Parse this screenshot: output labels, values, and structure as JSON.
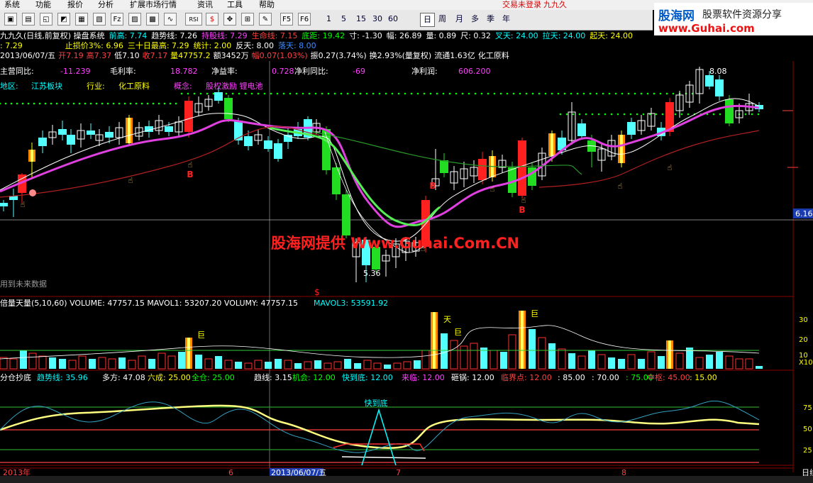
{
  "menu": [
    "系统",
    "功能",
    "报价",
    "分析",
    "扩展市场行情",
    "资讯",
    "工具",
    "帮助"
  ],
  "login_status": "交易未登录",
  "app_name": "九九久",
  "toolbar_periods": [
    "1",
    "5",
    "15",
    "30",
    "60",
    "日",
    "周",
    "月",
    "多",
    "季",
    "年"
  ],
  "toolbar_extra": [
    "RSI",
    "F5",
    "F6"
  ],
  "logo": {
    "brand": "股海网",
    "slogan": "股票软件资源分享",
    "url": "www.Guhai.com"
  },
  "title_bar": {
    "name": "九九久(日线,前复权) 操盘系统",
    "items": [
      {
        "label": "前高:",
        "value": "7.74",
        "color": "#00ffff"
      },
      {
        "label": "趋势线:",
        "value": "7.26",
        "color": "#ffffff"
      },
      {
        "label": "持股线:",
        "value": "7.29",
        "color": "#ff40ff"
      },
      {
        "label": "生命线:",
        "value": "7.15",
        "color": "#ff4040"
      },
      {
        "label": "底距:",
        "value": "19.42",
        "color": "#00ff00"
      },
      {
        "label": "寸:",
        "value": "-1.30",
        "color": "#ffffff"
      },
      {
        "label": "幅:",
        "value": "26.89",
        "color": "#ffffff"
      },
      {
        "label": "量:",
        "value": "0.89",
        "color": "#ffffff"
      },
      {
        "label": "尺:",
        "value": "0.32",
        "color": "#ffffff"
      },
      {
        "label": "叉天:",
        "value": "24.00",
        "color": "#00ffff"
      },
      {
        "label": "拉天:",
        "value": "24.00",
        "color": "#00ffff"
      },
      {
        "label": "起天:",
        "value": "24.00",
        "color": "#ffff00"
      }
    ]
  },
  "title_bar2": {
    "prefix": ": 7.29",
    "items": [
      {
        "label": "止损价3%:",
        "value": "6.96",
        "color": "#ffff00"
      },
      {
        "label": "三十日最高:",
        "value": "7.29",
        "color": "#ffff00"
      },
      {
        "label": "统计:",
        "value": "2.00",
        "color": "#ffff00"
      },
      {
        "label": "反天:",
        "value": "8.00",
        "color": "#ffffff"
      },
      {
        "label": "落天:",
        "value": "8.00",
        "color": "#3a8cff"
      }
    ]
  },
  "quote_line": {
    "date": "2013/06/07/五",
    "open": "开7.19",
    "high": "高7.37",
    "low": "低7.10",
    "close": "收7.17",
    "volume": "量47757.2",
    "amount": "额3452万",
    "change": "幅0.07(1.03%)",
    "amplitude": "振0.27(3.74%)",
    "turnover": "换2.93%(量复权)",
    "float": "流通1.63亿",
    "sector": "化工原料"
  },
  "fundamentals": [
    {
      "label": "主营同比:",
      "value": "-11.239"
    },
    {
      "label": "毛利率:",
      "value": "18.782"
    },
    {
      "label": "净益率:",
      "value": "0.728"
    },
    {
      "label": "净利同比:",
      "value": "-69"
    },
    {
      "label": "净利润:",
      "value": "606.200"
    }
  ],
  "region": {
    "region_label": "地区:",
    "region": "江苏板块",
    "industry_label": "行业:",
    "industry": "化工原料",
    "concept_label": "概念:",
    "concepts": "股权激励 锂电池"
  },
  "main_chart": {
    "price_marker": "6.16",
    "high_label": "8.08",
    "low_label": "5.36",
    "buy_signal": "B",
    "sell_signal": "$",
    "watermark": "股海网提供 Www.Guhai.Com.CN",
    "future_note": "用到未来数据"
  },
  "volume_panel": {
    "title": "倍量天量(5,10,60) VOLUME: 47757.15 MAVOL1: 53207.20 VOLUMY: 47757.15",
    "mavol3": "MAVOL3: 53591.92",
    "axis": [
      "30",
      "20",
      "10",
      "X10"
    ],
    "labels": [
      "巨",
      "天",
      "巨",
      "巨"
    ]
  },
  "osc_panel": {
    "items": [
      {
        "text": "分仓抄底",
        "color": "#ffffff"
      },
      {
        "text": "趋势线: 35.96",
        "color": "#00ffff"
      },
      {
        "text": "多方: 47.08",
        "color": "#ffffff"
      },
      {
        "text": "六成: 25.00",
        "color": "#ffff00"
      },
      {
        "text": "全仓: 25.00",
        "color": "#00ff00"
      },
      {
        "text": "趋线: 3.15",
        "color": "#ffffff"
      },
      {
        "text": "机会: 12.00",
        "color": "#00ff00"
      },
      {
        "text": "快到底: 12.00",
        "color": "#00ffff"
      },
      {
        "text": "来临: 12.00",
        "color": "#ff40ff"
      },
      {
        "text": "砸锅: 12.00",
        "color": "#ffffff"
      },
      {
        "text": "临界点: 12.00",
        "color": "#ff4040"
      },
      {
        "text": ": 85.00",
        "color": "#ffffff"
      },
      {
        "text": ": 70.00",
        "color": "#ffffff"
      },
      {
        "text": ": 75.00",
        "color": "#00ff00"
      },
      {
        "text": "中枢: 45.00",
        "color": "#ff4040"
      },
      {
        "text": ": 15.00",
        "color": "#ffff00"
      }
    ],
    "signal_label": "快到底",
    "axis": [
      "75",
      "50",
      "25"
    ]
  },
  "date_axis": {
    "year": "2013年",
    "ticks": [
      "6",
      "7",
      "8"
    ],
    "cursor": "2013/06/07/五",
    "right": "日线"
  }
}
